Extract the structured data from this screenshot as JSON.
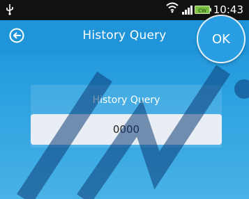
{
  "status_bar": {
    "time": "10:43",
    "battery_label": "CW"
  },
  "header": {
    "title": "History Query",
    "ok_label": "OK"
  },
  "panel": {
    "title": "History Query",
    "query_value": "0000"
  },
  "icons": {
    "back": "back-arrow-icon",
    "usb": "usb-icon",
    "wifi": "wifi-icon",
    "signal": "signal-icon",
    "battery": "battery-icon"
  },
  "colors": {
    "accent": "#1f94d9",
    "status_bar": "#111111",
    "input_bg": "#e8eef4"
  }
}
